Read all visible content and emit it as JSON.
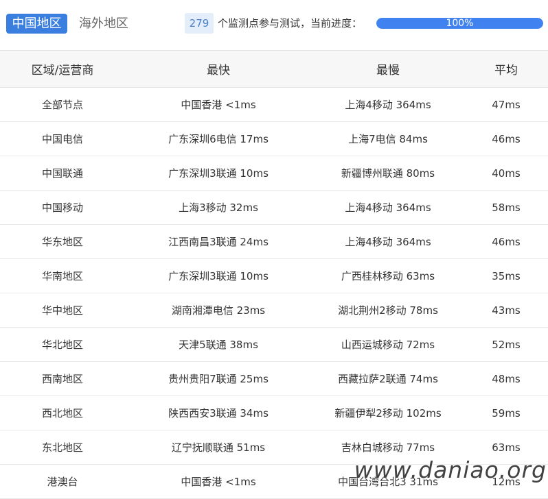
{
  "tabs": [
    {
      "label": "中国地区",
      "active": true
    },
    {
      "label": "海外地区",
      "active": false
    }
  ],
  "status": {
    "count": "279",
    "count_label": "个监测点参与测试，当前进度：",
    "progress_text": "100%",
    "progress_fraction": 1.0
  },
  "table": {
    "headers": [
      "区域/运营商",
      "最快",
      "最慢",
      "平均"
    ],
    "rows": [
      [
        "全部节点",
        "中国香港 <1ms",
        "上海4移动 364ms",
        "47ms"
      ],
      [
        "中国电信",
        "广东深圳6电信 17ms",
        "上海7电信 84ms",
        "46ms"
      ],
      [
        "中国联通",
        "广东深圳3联通 10ms",
        "新疆博州联通 80ms",
        "40ms"
      ],
      [
        "中国移动",
        "上海3移动 32ms",
        "上海4移动 364ms",
        "58ms"
      ],
      [
        "华东地区",
        "江西南昌3联通 24ms",
        "上海4移动 364ms",
        "46ms"
      ],
      [
        "华南地区",
        "广东深圳3联通 10ms",
        "广西桂林移动 63ms",
        "35ms"
      ],
      [
        "华中地区",
        "湖南湘潭电信 23ms",
        "湖北荆州2移动 78ms",
        "43ms"
      ],
      [
        "华北地区",
        "天津5联通 38ms",
        "山西运城移动 72ms",
        "52ms"
      ],
      [
        "西南地区",
        "贵州贵阳7联通 25ms",
        "西藏拉萨2联通 74ms",
        "48ms"
      ],
      [
        "西北地区",
        "陕西西安3联通 34ms",
        "新疆伊犁2移动 102ms",
        "59ms"
      ],
      [
        "东北地区",
        "辽宁抚顺联通 51ms",
        "吉林白城移动 77ms",
        "63ms"
      ],
      [
        "港澳台",
        "中国香港 <1ms",
        "中国台湾台北3 31ms",
        "12ms"
      ]
    ]
  },
  "watermark": "www.daniao.org",
  "colors": {
    "accent": "#3a7ee0",
    "progress": "#3f82f0",
    "badge_bg": "#e4eefb"
  }
}
